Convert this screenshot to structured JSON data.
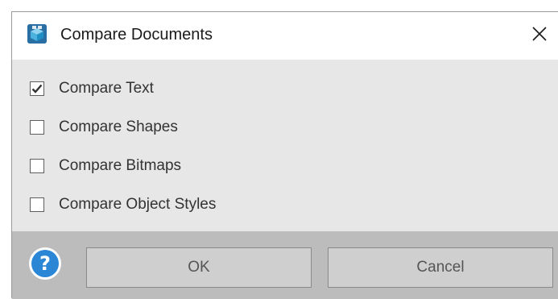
{
  "dialog": {
    "title": "Compare Documents",
    "icon": "compare-app-icon",
    "close_icon": "close-icon"
  },
  "options": [
    {
      "label": "Compare Text",
      "checked": true
    },
    {
      "label": "Compare Shapes",
      "checked": false
    },
    {
      "label": "Compare Bitmaps",
      "checked": false
    },
    {
      "label": "Compare Object Styles",
      "checked": false
    }
  ],
  "footer": {
    "help_icon": "help-icon",
    "help_glyph": "?",
    "ok_label": "OK",
    "cancel_label": "Cancel"
  },
  "colors": {
    "options_bg": "#e7e7e7",
    "footer_bg": "#bcbcbc",
    "help_blue": "#2b86d6",
    "button_bg": "#cfcfcf"
  }
}
